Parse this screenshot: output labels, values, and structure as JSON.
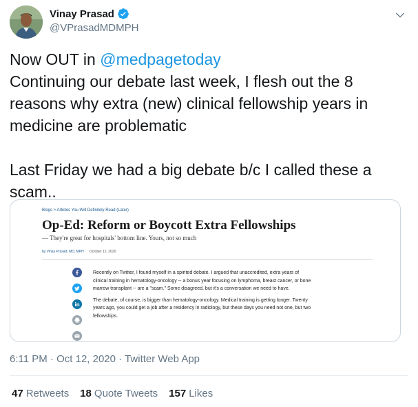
{
  "author": {
    "name": "Vinay Prasad",
    "handle": "@VPrasadMDMPH"
  },
  "tweet": {
    "line1_prefix": "Now OUT in ",
    "line1_mention": "@medpagetoday",
    "line2": "Continuing our debate last week, I flesh out the 8 reasons why extra (new) clinical fellowship years in medicine are problematic",
    "line3": "Last Friday we had a big debate b/c I called these a scam.."
  },
  "card": {
    "breadcrumbs": "Blogs  >  Articles You Will Definitely Read (Later)",
    "headline": "Op-Ed: Reform or Boycott Extra Fellowships",
    "dek": "— They're great for hospitals' bottom line. Yours, not so much",
    "byline": "by Vinay Prasad, MD, MPH",
    "date": "October 12, 2020",
    "paragraph1": "Recently on Twitter, I found myself in a spirited debate. I argued that unaccredited, extra years of clinical training in hematology-oncology -- a bonus year focusing on lymphoma, breast cancer, or bone marrow transplant -- are a \"scam.\" Some disagreed, but it's a conversation we need to have.",
    "paragraph2": "The debate, of course, is bigger than hematology-oncology. Medical training is getting longer. Twenty years ago, you could get a job after a residency in radiology, but these days you need not one, but two fellowships.",
    "share_icons": [
      "facebook-icon",
      "twitter-icon",
      "linkedin-icon",
      "print-icon",
      "email-icon"
    ]
  },
  "meta": {
    "time": "6:11 PM",
    "separator": " · ",
    "date": "Oct 12, 2020",
    "source": "Twitter Web App"
  },
  "stats": {
    "retweets_count": "47",
    "retweets_label": "Retweets",
    "quotes_count": "18",
    "quotes_label": "Quote Tweets",
    "likes_count": "157",
    "likes_label": "Likes"
  },
  "colors": {
    "link": "#1b95e0",
    "muted": "#657786",
    "text": "#14171a",
    "verified": "#1da1f2"
  }
}
